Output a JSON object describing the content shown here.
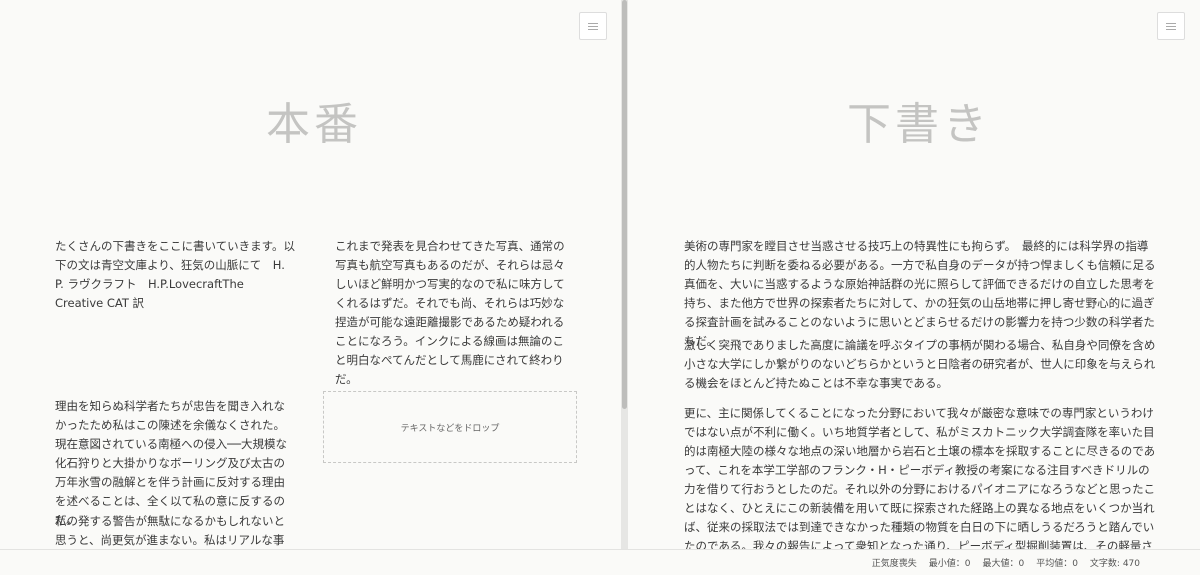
{
  "left_pane": {
    "title": "本番",
    "blocks": [
      "たくさんの下書きをここに書いていきます。以下の文は青空文庫より、狂気の山脈にて　H. P. ラヴクラフト　H.P.LovecraftThe Creative CAT 訳",
      "これまで発表を見合わせてきた写真、通常の写真も航空写真もあるのだが、それらは忌々しいほど鮮明かつ写実的なので私に味方してくれるはずだ。それでも尚、それらは巧妙な捏造が可能な遠距離撮影であるため疑われることになろう。インクによる線画は無論のこと明白なぺてんだとして馬鹿にされて終わりだ。",
      "理由を知らぬ科学者たちが忠告を聞き入れなかったため私はこの陳述を余儀なくされた。現在意図されている南極への侵入──大規模な化石狩りと大掛かりなボーリング及び太古の万年氷雪の融解とを伴う計画に反対する理由を述べることは、全く以て私の意に反するのだ。",
      "私の発する警告が無駄になるかもしれないと思うと、尚更気が進まない。私はリアルな事実を開示したいがわからなくなってしまうと思うと尚更気が"
    ],
    "dropzone_label": "テキストなどをドロップ"
  },
  "right_pane": {
    "title": "下書き",
    "blocks": [
      "美術の専門家を瞠目させ当惑させる技巧上の特異性にも拘らず。　最終的には科学界の指導的人物たちに判断を委ねる必要がある。一方で私自身のデータが持つ悍ましくも信頼に足る真価を、大いに当惑するような原始神話群の光に照らして評価できるだけの自立した思考を持ち、また他方で世界の探索者たちに対して、かの狂気の山岳地帯に押し寄せ野心的に過ぎる探査計画を試みることのないように思いとどまらせるだけの影響力を持つ少数の科学者たちだ。",
      "激しく突飛でありました高度に論議を呼ぶタイプの事柄が関わる場合、私自身や同僚を含め小さな大学にしか繋がりのないどちらかというと日陰者の研究者が、世人に印象を与えられる機会をほとんど持たぬことは不幸な事実である。",
      "更に、主に関係してくることになった分野において我々が厳密な意味での専門家というわけではない点が不利に働く。いち地質学者として、私がミスカトニック大学調査隊を率いた目的は南極大陸の様々な地点の深い地層から岩石と土壌の標本を採取することに尽きるのであって、これを本学工学部のフランク・H・ピーボディ教授の考案になる注目すべきドリルの力を借りて行おうとしたのだ。それ以外の分野におけるパイオニアになろうなどと思ったことはなく、ひとえにこの新装備を用いて既に探索された経路上の異なる地点をいくつか当れば、従来の採取法では到達できなかった種類の物質を白日の下に晒しうるだろうと踏んでいたのである。我々の報告によって衆知となった通り、ピーボディ型掘削装置は、その軽量さと可搬性とに加え、通常の掘抜用ドリルの原理と円形小型削岩機の原理とを組み合わせる能力によって、硬度が様々に変化する地層"
    ]
  },
  "status_bar": {
    "mode": "正気度喪失",
    "min": "最小値：0",
    "max": "最大値：0",
    "avg": "平均値：0",
    "chars": "文字数: 470"
  },
  "icons": {
    "menu": "hamburger-menu-icon"
  }
}
